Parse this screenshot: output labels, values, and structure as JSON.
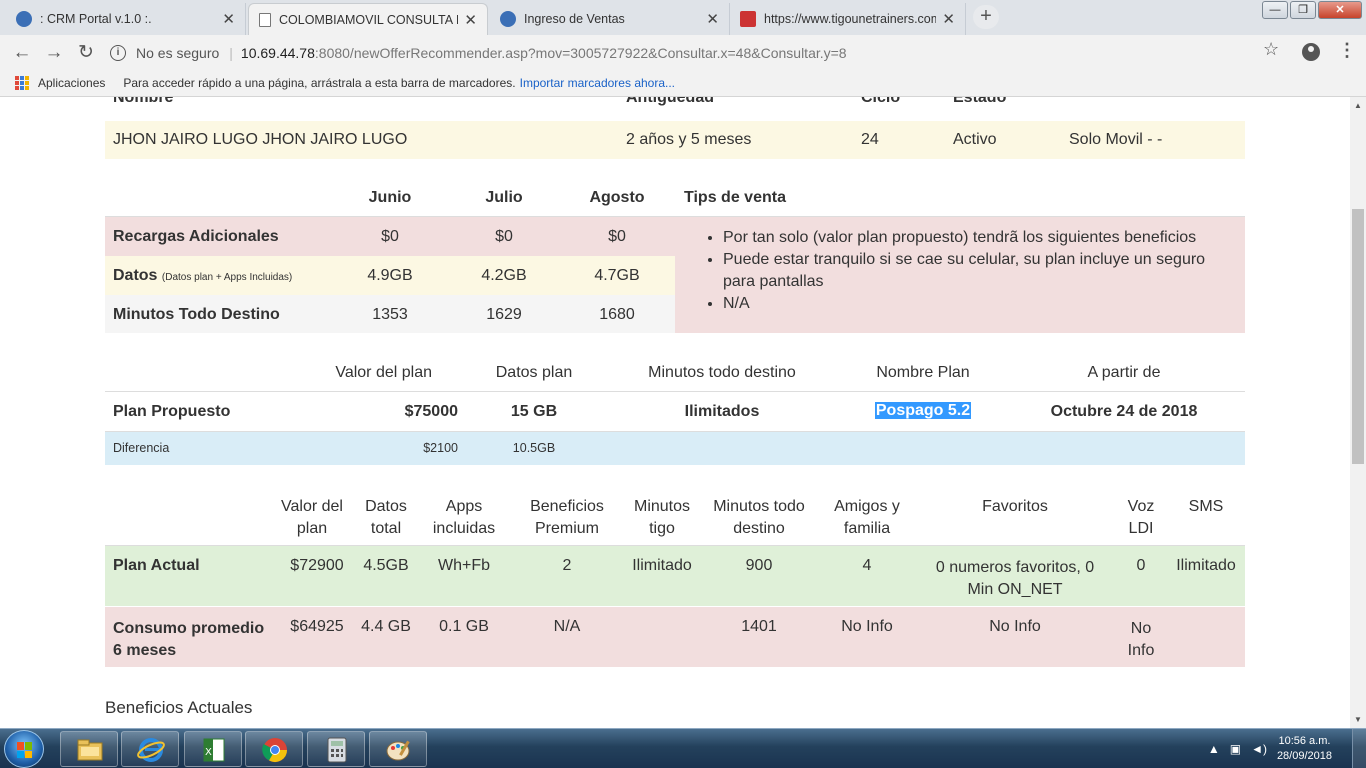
{
  "browser": {
    "tabs": [
      {
        "title": ": CRM Portal v.1.0 :.",
        "active": false,
        "favicon_color": "#3b6fb6"
      },
      {
        "title": "COLOMBIAMOVIL CONSULTA IN",
        "active": true,
        "favicon_color": "#ffffff"
      },
      {
        "title": "Ingreso de Ventas",
        "active": false,
        "favicon_color": "#3b6fb6"
      },
      {
        "title": "https://www.tigounetrainers.com",
        "active": false,
        "favicon_color": "#cc3333"
      }
    ],
    "window_buttons": {
      "minimize": "—",
      "maximize": "❐",
      "close": "✕"
    },
    "security_label": "No es seguro",
    "url_host": "10.69.44.78",
    "url_path": ":8080/newOfferRecommender.asp?mov=3005727922&Consultar.x=48&Consultar.y=8",
    "bookmarks": {
      "apps_label": "Aplicaciones",
      "hint": "Para acceder rápido a una página, arrástrala a esta barra de marcadores.",
      "import_link": "Importar marcadores ahora..."
    }
  },
  "client": {
    "headers_cutoff": {
      "name": "Nombre",
      "antiguedad": "Antigüedad",
      "ciclo": "Ciclo",
      "estado": "Estado"
    },
    "name": "JHON JAIRO LUGO JHON JAIRO LUGO",
    "antiguedad": "2 años y 5 meses",
    "ciclo": "24",
    "estado": "Activo",
    "tipo": "Solo Movil - -"
  },
  "consumo": {
    "months": [
      "Junio",
      "Julio",
      "Agosto"
    ],
    "tips_header": "Tips de venta",
    "rows": [
      {
        "label": "Recargas Adicionales",
        "sublabel": "",
        "values": [
          "$0",
          "$0",
          "$0"
        ]
      },
      {
        "label": "Datos",
        "sublabel": "(Datos plan + Apps Incluidas)",
        "values": [
          "4.9GB",
          "4.2GB",
          "4.7GB"
        ]
      },
      {
        "label": "Minutos Todo Destino",
        "sublabel": "",
        "values": [
          "1353",
          "1629",
          "1680"
        ]
      }
    ],
    "tips": [
      "Por tan solo (valor plan propuesto) tendrã los siguientes beneficios",
      "Puede estar tranquilo si se cae su celular, su plan incluye un seguro para pantallas",
      "N/A"
    ]
  },
  "propuesta": {
    "headers": [
      "Valor del plan",
      "Datos plan",
      "Minutos todo destino",
      "Nombre Plan",
      "A partir de"
    ],
    "label": "Plan Propuesto",
    "valor": "$75000",
    "datos": "15 GB",
    "minutos": "Ilimitados",
    "nombre": "Pospago 5.2",
    "desde": "Octubre 24 de 2018",
    "diferencia_label": "Diferencia",
    "diferencia_valor": "$2100",
    "diferencia_datos": "10.5GB"
  },
  "actual": {
    "headers": [
      "Valor del plan",
      "Datos total",
      "Apps incluidas",
      "Beneficios Premium",
      "Minutos tigo",
      "Minutos todo destino",
      "Amigos y familia",
      "Favoritos",
      "Voz LDI",
      "SMS"
    ],
    "plan_row": {
      "label": "Plan Actual",
      "values": [
        "$72900",
        "4.5GB",
        "Wh+Fb",
        "2",
        "Ilimitado",
        "900",
        "4",
        "0 numeros favoritos, 0 Min ON_NET",
        "0",
        "Ilimitado"
      ]
    },
    "consumo_row": {
      "label": "Consumo promedio 6 meses",
      "values": [
        "$64925",
        "4.4 GB",
        "0.1 GB",
        "N/A",
        "",
        "1401",
        "No Info",
        "No Info",
        "No Info",
        ""
      ]
    }
  },
  "beneficios_title": "Beneficios Actuales",
  "taskbar": {
    "time": "10:56 a.m.",
    "date": "28/09/2018",
    "apps": [
      "explorer-icon",
      "internet-explorer-icon",
      "excel-icon",
      "chrome-icon",
      "calculator-icon",
      "paint-icon"
    ]
  }
}
